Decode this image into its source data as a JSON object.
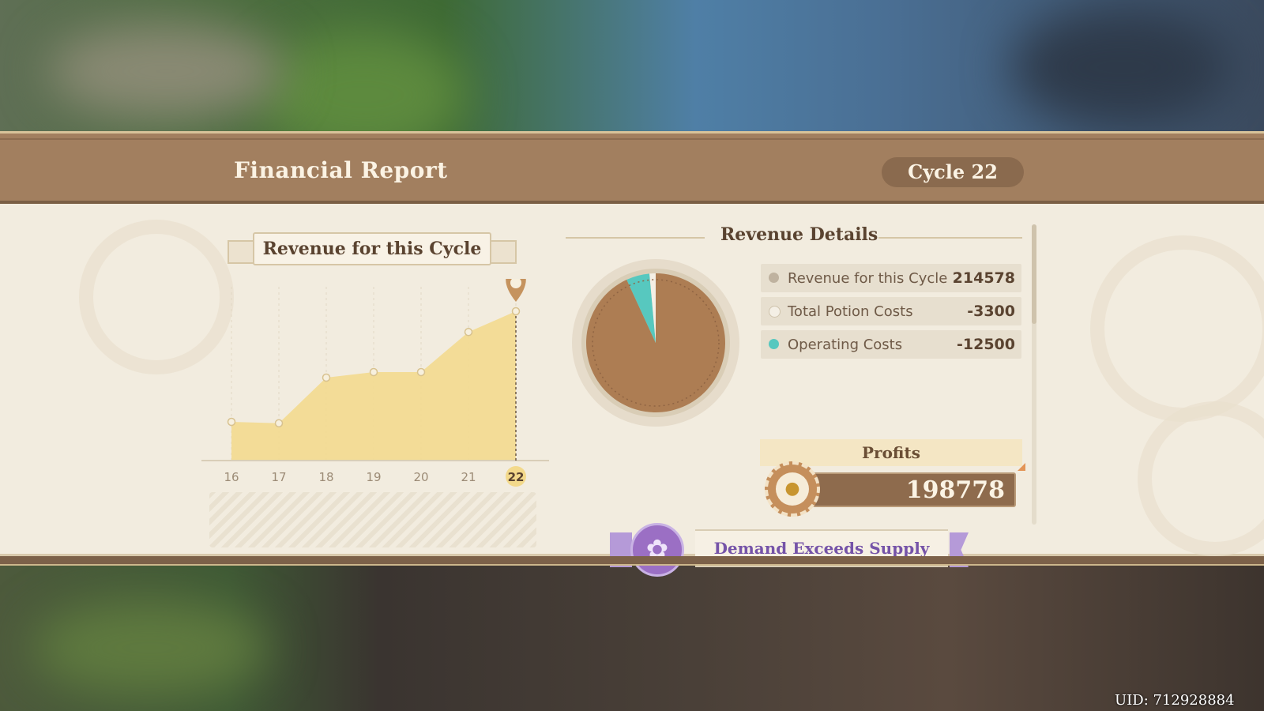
{
  "header": {
    "title": "Financial Report",
    "cycle_label": "Cycle 22"
  },
  "chart_section": {
    "banner": "Revenue for this Cycle"
  },
  "chart_data": {
    "type": "area",
    "categories": [
      "16",
      "17",
      "18",
      "19",
      "20",
      "21",
      "22"
    ],
    "values": [
      0.28,
      0.27,
      0.6,
      0.64,
      0.64,
      0.93,
      1.08
    ],
    "ylim": [
      0,
      1.2
    ],
    "highlight_category": "22",
    "fill_color": "#f3d98b",
    "point_color": "#f7f0de",
    "marker_color": "#c5935e"
  },
  "revenue_details": {
    "title": "Revenue Details",
    "rows": [
      {
        "label": "Revenue for this Cycle",
        "value": "214578",
        "dot_color": "#bfb29f"
      },
      {
        "label": "Total Potion Costs",
        "value": "-3300",
        "dot_color": "#f4efe5"
      },
      {
        "label": "Operating Costs",
        "value": "-12500",
        "dot_color": "#57c8bf"
      }
    ],
    "pie": {
      "slices": [
        {
          "name": "Revenue for this Cycle",
          "value": 214578,
          "color": "#ad7d53"
        },
        {
          "name": "Total Potion Costs",
          "value": 3300,
          "color": "#f4efe5"
        },
        {
          "name": "Operating Costs",
          "value": 12500,
          "color": "#57c8bf"
        }
      ]
    },
    "profits_label": "Profits",
    "profits_value": "198778",
    "status_text": "Demand Exceeds Supply",
    "accent_purple": "#9b6fc4"
  },
  "footer": {
    "uid": "UID: 712928884"
  }
}
